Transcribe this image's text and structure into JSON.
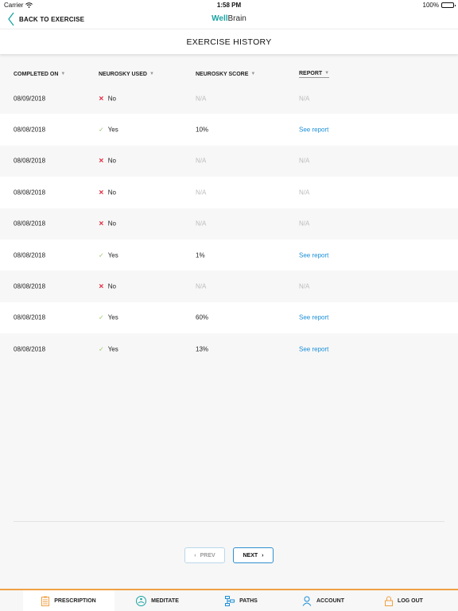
{
  "status_bar": {
    "carrier": "Carrier",
    "time": "1:58 PM",
    "battery": "100%"
  },
  "nav": {
    "back_label": "BACK TO EXERCISE",
    "logo_part1": "Well",
    "logo_part2": "Brain"
  },
  "page": {
    "title": "EXERCISE HISTORY"
  },
  "table": {
    "columns": [
      "COMPLETED ON",
      "NEUROSKY USED",
      "NEUROSKY SCORE",
      "REPORT"
    ],
    "rows": [
      {
        "completed_on": "08/09/2018",
        "used": "No",
        "score": "N/A",
        "report": "N/A"
      },
      {
        "completed_on": "08/08/2018",
        "used": "Yes",
        "score": "10%",
        "report": "See report"
      },
      {
        "completed_on": "08/08/2018",
        "used": "No",
        "score": "N/A",
        "report": "N/A"
      },
      {
        "completed_on": "08/08/2018",
        "used": "No",
        "score": "N/A",
        "report": "N/A"
      },
      {
        "completed_on": "08/08/2018",
        "used": "No",
        "score": "N/A",
        "report": "N/A"
      },
      {
        "completed_on": "08/08/2018",
        "used": "Yes",
        "score": "1%",
        "report": "See report"
      },
      {
        "completed_on": "08/08/2018",
        "used": "No",
        "score": "N/A",
        "report": "N/A"
      },
      {
        "completed_on": "08/08/2018",
        "used": "Yes",
        "score": "60%",
        "report": "See report"
      },
      {
        "completed_on": "08/08/2018",
        "used": "Yes",
        "score": "13%",
        "report": "See report"
      }
    ]
  },
  "pagination": {
    "prev_label": "PREV",
    "next_label": "NEXT"
  },
  "tabs": [
    {
      "label": "PRESCRIPTION",
      "icon": "clipboard-icon",
      "active": true
    },
    {
      "label": "MEDITATE",
      "icon": "meditate-icon",
      "active": false
    },
    {
      "label": "PATHS",
      "icon": "paths-icon",
      "active": false
    },
    {
      "label": "ACCOUNT",
      "icon": "account-icon",
      "active": false
    },
    {
      "label": "LOG OUT",
      "icon": "lock-icon",
      "active": false
    }
  ],
  "colors": {
    "accent_orange": "#f0a043",
    "link_blue": "#1b8fd6",
    "brand_teal": "#1aa3a3",
    "no_red": "#e2263b",
    "yes_green": "#9ac66a"
  }
}
